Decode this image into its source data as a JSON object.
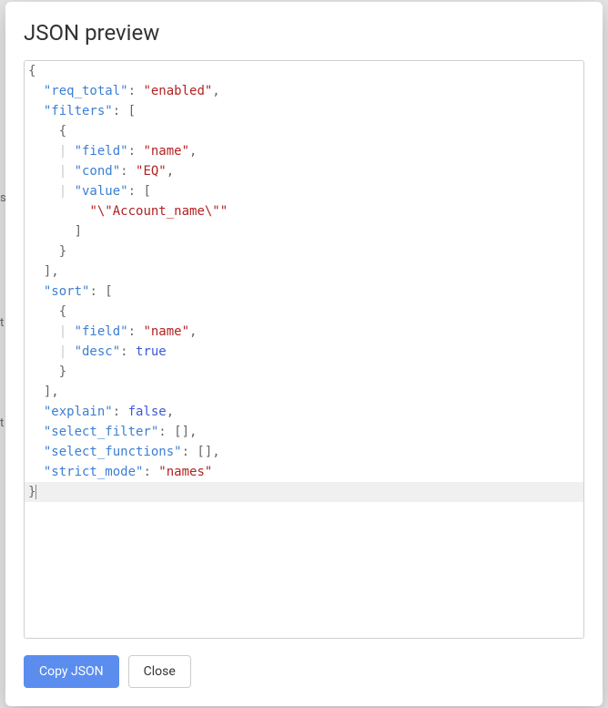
{
  "modal": {
    "title": "JSON preview"
  },
  "code": {
    "lines": [
      {
        "indent": 0,
        "tokens": [
          {
            "t": "p",
            "v": "{"
          }
        ]
      },
      {
        "indent": 1,
        "tokens": [
          {
            "t": "k",
            "v": "\"req_total\""
          },
          {
            "t": "p",
            "v": ": "
          },
          {
            "t": "s",
            "v": "\"enabled\""
          },
          {
            "t": "p",
            "v": ","
          }
        ]
      },
      {
        "indent": 1,
        "tokens": [
          {
            "t": "k",
            "v": "\"filters\""
          },
          {
            "t": "p",
            "v": ": ["
          }
        ]
      },
      {
        "indent": 2,
        "tokens": [
          {
            "t": "p",
            "v": "{"
          }
        ]
      },
      {
        "indent": 3,
        "guide": true,
        "tokens": [
          {
            "t": "k",
            "v": "\"field\""
          },
          {
            "t": "p",
            "v": ": "
          },
          {
            "t": "s",
            "v": "\"name\""
          },
          {
            "t": "p",
            "v": ","
          }
        ]
      },
      {
        "indent": 3,
        "guide": true,
        "tokens": [
          {
            "t": "k",
            "v": "\"cond\""
          },
          {
            "t": "p",
            "v": ": "
          },
          {
            "t": "s",
            "v": "\"EQ\""
          },
          {
            "t": "p",
            "v": ","
          }
        ]
      },
      {
        "indent": 3,
        "guide": true,
        "tokens": [
          {
            "t": "k",
            "v": "\"value\""
          },
          {
            "t": "p",
            "v": ": ["
          }
        ]
      },
      {
        "indent": 4,
        "tokens": [
          {
            "t": "s",
            "v": "\"\\\"Account_name\\\"\""
          }
        ]
      },
      {
        "indent": 3,
        "tokens": [
          {
            "t": "p",
            "v": "]"
          }
        ]
      },
      {
        "indent": 2,
        "tokens": [
          {
            "t": "p",
            "v": "}"
          }
        ]
      },
      {
        "indent": 1,
        "tokens": [
          {
            "t": "p",
            "v": "],"
          }
        ]
      },
      {
        "indent": 1,
        "tokens": [
          {
            "t": "k",
            "v": "\"sort\""
          },
          {
            "t": "p",
            "v": ": ["
          }
        ]
      },
      {
        "indent": 2,
        "tokens": [
          {
            "t": "p",
            "v": "{"
          }
        ]
      },
      {
        "indent": 3,
        "guide": true,
        "tokens": [
          {
            "t": "k",
            "v": "\"field\""
          },
          {
            "t": "p",
            "v": ": "
          },
          {
            "t": "s",
            "v": "\"name\""
          },
          {
            "t": "p",
            "v": ","
          }
        ]
      },
      {
        "indent": 3,
        "guide": true,
        "tokens": [
          {
            "t": "k",
            "v": "\"desc\""
          },
          {
            "t": "p",
            "v": ": "
          },
          {
            "t": "b",
            "v": "true"
          }
        ]
      },
      {
        "indent": 2,
        "tokens": [
          {
            "t": "p",
            "v": "}"
          }
        ]
      },
      {
        "indent": 1,
        "tokens": [
          {
            "t": "p",
            "v": "],"
          }
        ]
      },
      {
        "indent": 1,
        "tokens": [
          {
            "t": "k",
            "v": "\"explain\""
          },
          {
            "t": "p",
            "v": ": "
          },
          {
            "t": "b",
            "v": "false"
          },
          {
            "t": "p",
            "v": ","
          }
        ]
      },
      {
        "indent": 1,
        "tokens": [
          {
            "t": "k",
            "v": "\"select_filter\""
          },
          {
            "t": "p",
            "v": ": [],"
          }
        ]
      },
      {
        "indent": 1,
        "tokens": [
          {
            "t": "k",
            "v": "\"select_functions\""
          },
          {
            "t": "p",
            "v": ": [],"
          }
        ]
      },
      {
        "indent": 1,
        "tokens": [
          {
            "t": "k",
            "v": "\"strict_mode\""
          },
          {
            "t": "p",
            "v": ": "
          },
          {
            "t": "s",
            "v": "\"names\""
          }
        ]
      },
      {
        "indent": 0,
        "hl": true,
        "tokens": [
          {
            "t": "p",
            "v": "}"
          }
        ],
        "caret": true
      }
    ]
  },
  "footer": {
    "copy_label": "Copy JSON",
    "close_label": "Close"
  },
  "background_hints": [
    "s",
    "t",
    "t"
  ]
}
